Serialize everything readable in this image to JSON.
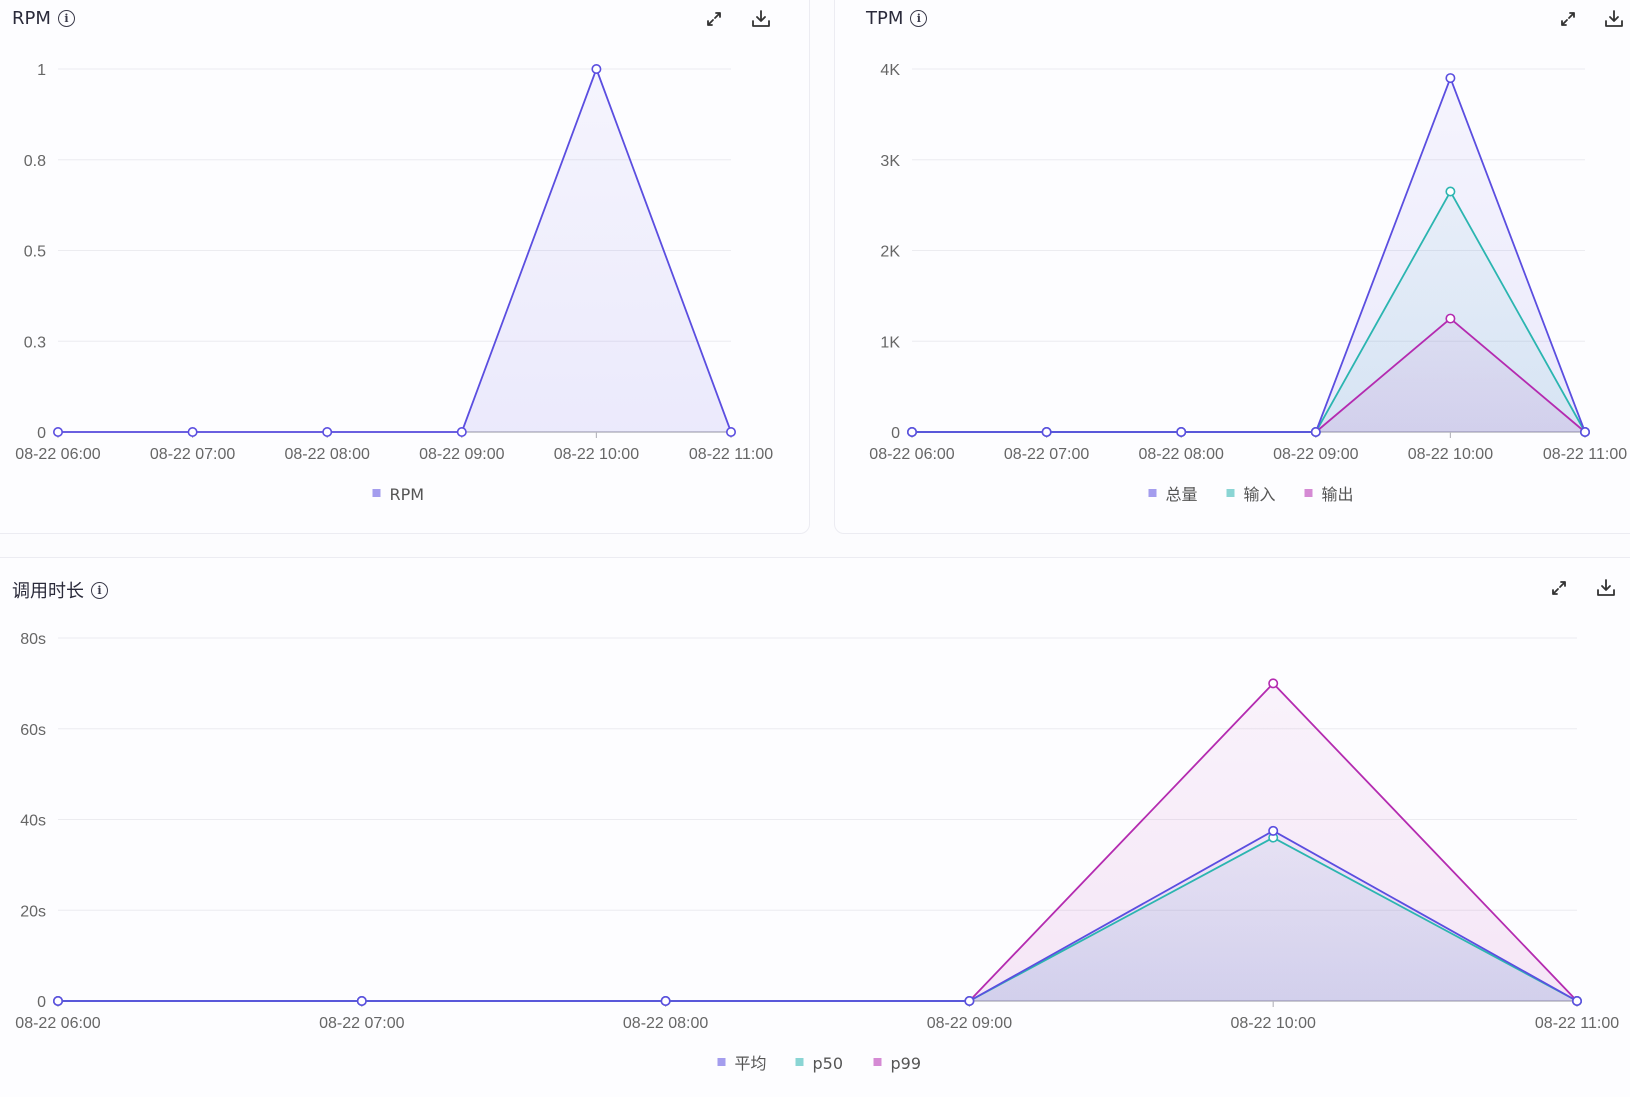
{
  "panels": {
    "rpm": {
      "title": "RPM"
    },
    "tpm": {
      "title": "TPM"
    },
    "duration": {
      "title": "调用时长"
    }
  },
  "icons": {
    "info": "info-circle-icon",
    "expand": "expand-icon",
    "download": "download-icon"
  },
  "chart_data": [
    {
      "id": "rpm",
      "type": "area",
      "title": "RPM",
      "categories": [
        "08-22 06:00",
        "08-22 07:00",
        "08-22 08:00",
        "08-22 09:00",
        "08-22 10:00",
        "08-22 11:00"
      ],
      "yticks": [
        "0",
        "0.3",
        "0.5",
        "0.8",
        "1"
      ],
      "ylim": [
        0,
        1
      ],
      "grid": true,
      "legend_position": "bottom-center",
      "series": [
        {
          "name": "RPM",
          "color": "#5b4ee0",
          "values": [
            0,
            0,
            0,
            0,
            1,
            0
          ]
        }
      ]
    },
    {
      "id": "tpm",
      "type": "area",
      "title": "TPM",
      "categories": [
        "08-22 06:00",
        "08-22 07:00",
        "08-22 08:00",
        "08-22 09:00",
        "08-22 10:00",
        "08-22 11:00"
      ],
      "yticks": [
        "0",
        "1K",
        "2K",
        "3K",
        "4K"
      ],
      "ylim": [
        0,
        4000
      ],
      "grid": true,
      "legend_position": "bottom-center",
      "series": [
        {
          "name": "总量",
          "color": "#5b4ee0",
          "values": [
            0,
            0,
            0,
            0,
            3900,
            0
          ]
        },
        {
          "name": "输入",
          "color": "#2bb5b0",
          "values": [
            0,
            0,
            0,
            0,
            2650,
            0
          ]
        },
        {
          "name": "输出",
          "color": "#b42bb0",
          "values": [
            0,
            0,
            0,
            0,
            1250,
            0
          ]
        }
      ]
    },
    {
      "id": "duration",
      "type": "area",
      "title": "调用时长",
      "categories": [
        "08-22 06:00",
        "08-22 07:00",
        "08-22 08:00",
        "08-22 09:00",
        "08-22 10:00",
        "08-22 11:00"
      ],
      "yticks": [
        "0",
        "20s",
        "40s",
        "60s",
        "80s"
      ],
      "ylim": [
        0,
        80
      ],
      "grid": true,
      "legend_position": "bottom-center",
      "series": [
        {
          "name": "平均",
          "color": "#5b4ee0",
          "values": [
            0,
            0,
            0,
            0,
            37.5,
            0
          ]
        },
        {
          "name": "p50",
          "color": "#2bb5b0",
          "values": [
            0,
            0,
            0,
            0,
            36,
            0
          ]
        },
        {
          "name": "p99",
          "color": "#b42bb0",
          "values": [
            0,
            0,
            0,
            0,
            70,
            0
          ]
        }
      ]
    }
  ]
}
